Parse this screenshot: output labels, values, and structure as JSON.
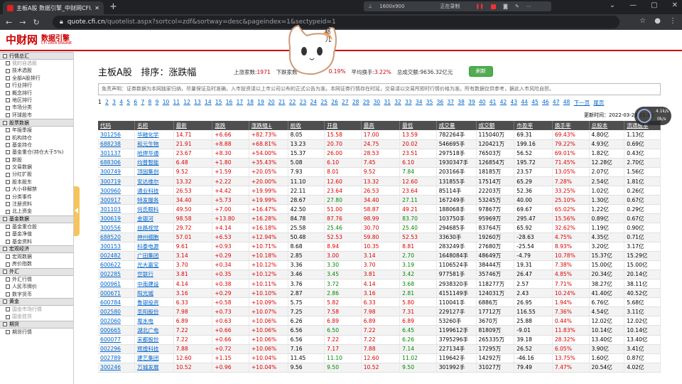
{
  "browser": {
    "tab_title": "主板A股 数据引擎_中财网CFI.CN",
    "url_host": "quote.cfi.cn",
    "url_path": "/quotelist.aspx?sortcol=zdf&sortway=desc&pageindex=1&sectypeid=1",
    "recorder_resolution": "1600x900",
    "recorder_status": "正在录制"
  },
  "site": {
    "logo": "中财网",
    "logo_sub": "数据引擎",
    "logo_en": "CFI DATA ENGINE"
  },
  "sidebar": [
    {
      "section": "行情总汇",
      "items": [
        "我的自选股",
        "技术选股",
        "全部A股排行",
        "行业排行",
        "概念排行",
        "地区排行",
        "市场分类",
        "环球股市"
      ]
    },
    {
      "section": "股票数据",
      "items": [
        "年报季报",
        "机构持仓",
        "基金持仓",
        "基金重仓(持仓大于5%)",
        "新股",
        "交易数据",
        "分红扩股",
        "股本股东",
        "大小非解禁",
        "分类事件",
        "注册资料",
        "北上资金"
      ]
    },
    {
      "section": "基金数据",
      "items": [
        "基金重仓股",
        "基金净值",
        "基金资料"
      ]
    },
    {
      "section": "宏观经济",
      "items": [
        "宏观数据",
        "房价指数"
      ]
    },
    {
      "section": "外汇",
      "items": [
        "外汇行情",
        "人民币牌价",
        "数字货币"
      ]
    },
    {
      "section": "黄金",
      "items": [
        "国金市场行情",
        "国金挂货"
      ]
    },
    {
      "section": "期货",
      "items": [
        "期货行情"
      ]
    }
  ],
  "page": {
    "title": "主板A股",
    "sort_label": "排序：",
    "sort_value": "涨跌幅",
    "up_label": "上涨家数:",
    "up_value": "1971",
    "down_label": "下跌家数",
    "avg_change": "0.19%",
    "avg_turnover_label": "平均换手:",
    "avg_turnover": "3.22%",
    "total_amount_label": "总成交额:",
    "total_amount": "9636.32亿元",
    "refresh_button": "刷新",
    "notice": "免责声明：证券数据为本网独家归纳，尽量保证及时准确，入市投资请以上市公司公布的正式公告为准。本网证券行情存在时延，交易请以交易所即时行情价格为准。所有数据仅供参考，据此入市风险自担。",
    "updated": "更新时间：2022-03-28 11:30",
    "mascot_text": "这儿"
  },
  "pager": [
    "1",
    "2",
    "3",
    "4",
    "5",
    "6",
    "7",
    "8",
    "9",
    "10",
    "11",
    "12",
    "13",
    "14",
    "15",
    "16",
    "17",
    "18",
    "19",
    "20",
    "21",
    "22",
    "23",
    "24",
    "25",
    "26",
    "27",
    "28",
    "29",
    "30",
    "31",
    "32",
    "33",
    "34",
    "35",
    "36",
    "37",
    "38",
    "39",
    "40",
    "41",
    "42",
    "43",
    "44",
    "45",
    "46",
    "47",
    "48",
    "下一页",
    "尾页"
  ],
  "clock": {
    "a": "4.1k/s",
    "b": "0k/s",
    "pct": "76"
  },
  "table": {
    "headers": [
      "代码",
      "名称",
      "最新",
      "涨跌",
      "涨跌幅↓",
      "前收",
      "开盘",
      "最高",
      "最低",
      "成交量",
      "成交额",
      "市盈率",
      "换手率",
      "总股本",
      "流通股本"
    ],
    "rows": [
      [
        "301256",
        "华融化学",
        "14.71",
        "+6.66",
        "+82.73%",
        "8.05",
        "15.58",
        "17.00",
        "13.59",
        "782264手",
        "115040万",
        "69.31",
        "69.43%",
        "4.80亿",
        "1.13亿"
      ],
      [
        "688238",
        "和元生物",
        "21.91",
        "+8.88",
        "+68.81%",
        "13.23",
        "20.70",
        "24.75",
        "20.02",
        "546695手",
        "120421万",
        "199.16",
        "79.22%",
        "4.93亿",
        "0.69亿"
      ],
      [
        "301137",
        "哈焊华通",
        "23.67",
        "+8.30",
        "+54.00%",
        "15.37",
        "26.00",
        "28.53",
        "23.51",
        "297518手",
        "76503万",
        "56.52",
        "69.01%",
        "1.82亿",
        "0.43亿"
      ],
      [
        "688306",
        "均普智能",
        "6.48",
        "+1.80",
        "+35.43%",
        "5.08",
        "6.10",
        "7.45",
        "6.10",
        "1930347手",
        "126854万",
        "195.72",
        "71.45%",
        "12.28亿",
        "2.70亿"
      ],
      [
        "300749",
        "顶固集创",
        "9.52",
        "+1.59",
        "+20.05%",
        "7.93",
        "8.01",
        "9.52",
        "7.84",
        "203166手",
        "18185万",
        "23.57",
        "13.05%",
        "2.07亿",
        "1.56亿"
      ],
      [
        "300719",
        "安达维尔",
        "13.32",
        "+2.22",
        "+20.00%",
        "11.10",
        "12.60",
        "13.32",
        "12.60",
        "131855手",
        "17514万",
        "65.29",
        "7.28%",
        "2.54亿",
        "1.81亿"
      ],
      [
        "300960",
        "通业科技",
        "26.53",
        "+4.42",
        "+19.99%",
        "22.11",
        "23.64",
        "26.53",
        "23.64",
        "85114手",
        "22203万",
        "52.36",
        "33.25%",
        "1.02亿",
        "0.26亿"
      ],
      [
        "300917",
        "特发服务",
        "34.40",
        "+5.73",
        "+19.99%",
        "28.67",
        "27.80",
        "34.40",
        "27.11",
        "167249手",
        "53245万",
        "40.00",
        "25.10%",
        "1.30亿",
        "0.67亿"
      ],
      [
        "301103",
        "何氏眼科",
        "49.50",
        "+7.00",
        "+16.47%",
        "42.50",
        "51.00",
        "58.87",
        "49.21",
        "188068手",
        "97867万",
        "69.67",
        "65.02%",
        "1.22亿",
        "0.29亿"
      ],
      [
        "300619",
        "金银河",
        "98.58",
        "+13.80",
        "+16.28%",
        "84.78",
        "87.76",
        "98.99",
        "83.70",
        "103750手",
        "95969万",
        "295.47",
        "15.56%",
        "0.89亿",
        "0.67亿"
      ],
      [
        "300556",
        "丝路视觉",
        "29.72",
        "+4.14",
        "+16.18%",
        "25.58",
        "25.46",
        "30.70",
        "25.40",
        "294685手",
        "83764万",
        "65.92",
        "32.62%",
        "1.19亿",
        "0.90亿"
      ],
      [
        "688520",
        "神州细胞",
        "57.01",
        "+6.53",
        "+12.94%",
        "50.48",
        "52.53",
        "59.80",
        "52.53",
        "33630手",
        "19260万",
        "-28.63",
        "4.75%",
        "4.35亿",
        "0.71亿"
      ],
      [
        "300153",
        "科泰电源",
        "9.61",
        "+0.93",
        "+10.71%",
        "8.68",
        "8.94",
        "10.35",
        "8.81",
        "283249手",
        "27680万",
        "-25.54",
        "8.93%",
        "3.20亿",
        "3.17亿"
      ],
      [
        "002482",
        "广田集团",
        "3.14",
        "+0.29",
        "+10.18%",
        "2.85",
        "3.00",
        "3.14",
        "2.70",
        "1648084手",
        "48649万",
        "-4.79",
        "10.78%",
        "15.37亿",
        "15.29亿"
      ],
      [
        "600622",
        "光大嘉宝",
        "3.70",
        "+0.34",
        "+10.12%",
        "3.36",
        "3.30",
        "3.70",
        "3.19",
        "1106524手",
        "38444万",
        "19.31",
        "7.38%",
        "15.00亿",
        "15.00亿"
      ],
      [
        "002285",
        "世联行",
        "3.81",
        "+0.35",
        "+10.12%",
        "3.46",
        "3.45",
        "3.81",
        "3.42",
        "977581手",
        "35746万",
        "26.47",
        "4.85%",
        "20.34亿",
        "20.14亿"
      ],
      [
        "000961",
        "中南建设",
        "4.14",
        "+0.38",
        "+10.11%",
        "3.76",
        "3.72",
        "4.14",
        "3.68",
        "2938320手",
        "118277万",
        "2.57",
        "7.71%",
        "38.27亿",
        "38.11亿"
      ],
      [
        "000671",
        "阳光城",
        "3.16",
        "+0.29",
        "+10.10%",
        "2.87",
        "2.86",
        "3.16",
        "2.81",
        "4151149手",
        "124031万",
        "2.43",
        "10.24%",
        "41.40亿",
        "40.52亿"
      ],
      [
        "600784",
        "鲁银投资",
        "6.33",
        "+0.58",
        "+10.09%",
        "5.75",
        "5.82",
        "6.33",
        "5.80",
        "110041手",
        "6886万",
        "26.95",
        "1.94%",
        "6.76亿",
        "5.68亿"
      ],
      [
        "002580",
        "圣阳股份",
        "7.98",
        "+0.73",
        "+10.07%",
        "7.25",
        "7.58",
        "7.98",
        "7.31",
        "229127手",
        "17712万",
        "116.55",
        "7.36%",
        "4.54亿",
        "3.11亿"
      ],
      [
        "002060",
        "粤水电",
        "6.89",
        "+0.63",
        "+10.06%",
        "6.26",
        "6.89",
        "6.89",
        "6.89",
        "53260手",
        "3670万",
        "25.88",
        "0.44%",
        "12.02亿",
        "12.02亿"
      ],
      [
        "000665",
        "湖北广电",
        "7.22",
        "+0.66",
        "+10.06%",
        "6.56",
        "6.50",
        "7.22",
        "6.45",
        "1199612手",
        "81809万",
        "-9.01",
        "11.83%",
        "10.14亿",
        "10.14亿"
      ],
      [
        "600077",
        "宋都股份",
        "7.22",
        "+0.66",
        "+10.06%",
        "6.56",
        "7.22",
        "7.22",
        "6.26",
        "3795296手",
        "265335万",
        "39.18",
        "28.32%",
        "13.40亿",
        "13.40亿"
      ],
      [
        "002296",
        "辉煌科技",
        "7.88",
        "+0.72",
        "+10.06%",
        "7.16",
        "7.17",
        "7.88",
        "7.14",
        "227134手",
        "17295万",
        "26.52",
        "6.05%",
        "3.90亿",
        "3.41亿"
      ],
      [
        "002789",
        "建艺集团",
        "12.60",
        "+1.15",
        "+10.04%",
        "11.45",
        "11.10",
        "12.60",
        "11.02",
        "119642手",
        "14292万",
        "-46.16",
        "13.75%",
        "1.60亿",
        "0.87亿"
      ],
      [
        "300246",
        "万城发展",
        "10.52",
        "+0.96",
        "+10.04%",
        "9.56",
        "9.50",
        "10.52",
        "9.50",
        "301992手",
        "31027万",
        "79.49",
        "7.47%",
        "20.54亿",
        "4.02亿"
      ]
    ]
  },
  "colors": {
    "brand": "#cc0000",
    "up": "#dd0000",
    "down": "#008800",
    "header": "#4f4f4f"
  }
}
